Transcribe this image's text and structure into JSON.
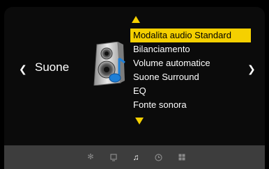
{
  "menu": {
    "category": "Suone",
    "items": [
      {
        "label": "Modalita audio Standard",
        "selected": true
      },
      {
        "label": "Bilanciamento",
        "selected": false
      },
      {
        "label": "Volume automatice",
        "selected": false
      },
      {
        "label": "Suone Surround",
        "selected": false
      },
      {
        "label": "EQ",
        "selected": false
      },
      {
        "label": "Fonte sonora",
        "selected": false
      }
    ]
  },
  "colors": {
    "highlight": "#f5d000",
    "background": "#000000",
    "bottom_bar": "#3d3d3d",
    "inactive_icon": "#8a8a8a",
    "active_icon": "#ffffff"
  },
  "bottom_tabs": [
    {
      "icon": "picture-settings-icon",
      "active": false
    },
    {
      "icon": "screen-icon",
      "active": false
    },
    {
      "icon": "music-note-icon",
      "active": true
    },
    {
      "icon": "clock-icon",
      "active": false
    },
    {
      "icon": "grid-icon",
      "active": false
    }
  ]
}
